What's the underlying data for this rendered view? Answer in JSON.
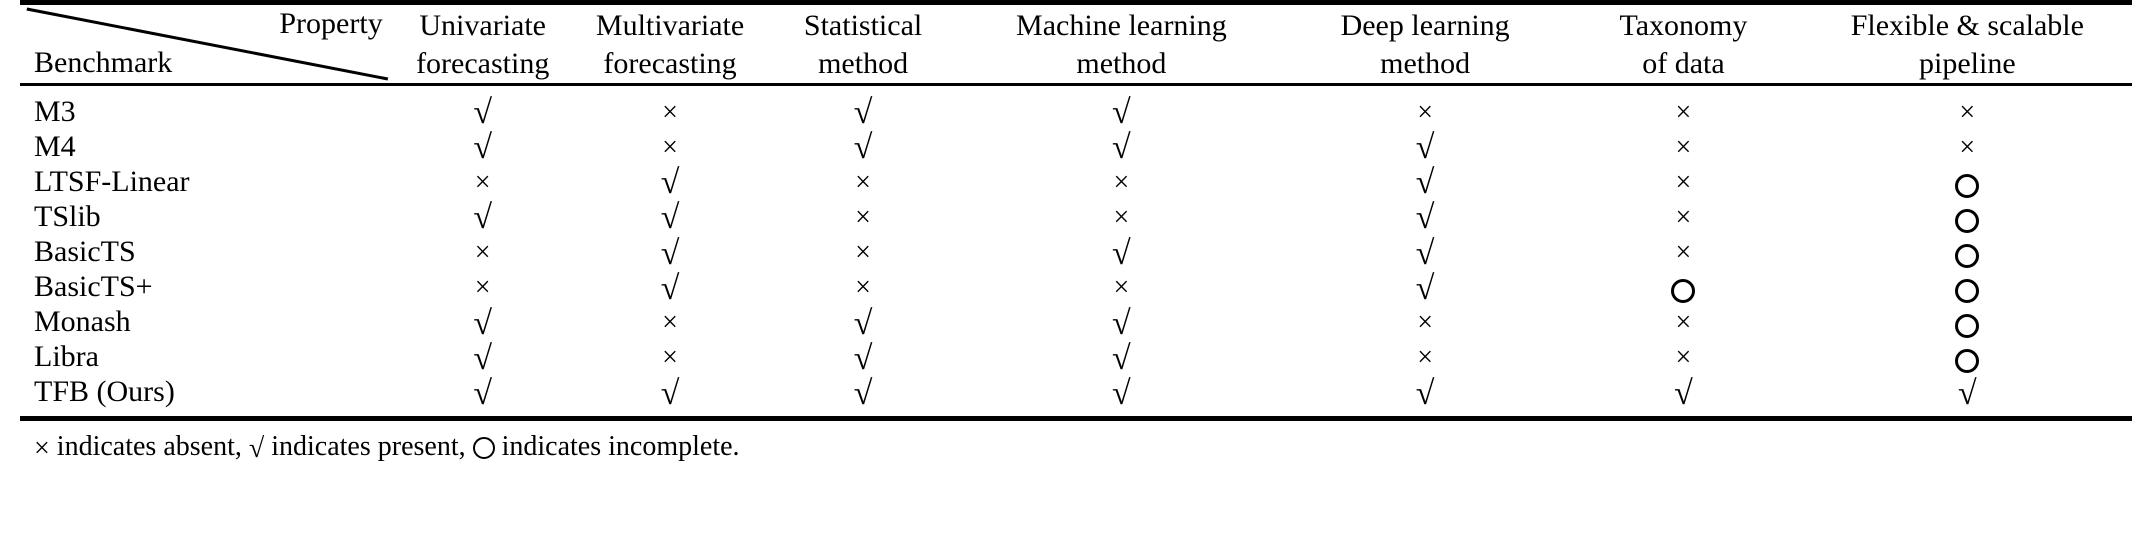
{
  "table": {
    "corner": {
      "property_label": "Property",
      "benchmark_label": "Benchmark"
    },
    "columns": [
      {
        "line1": "Univariate",
        "line2": "forecasting"
      },
      {
        "line1": "Multivariate",
        "line2": "forecasting"
      },
      {
        "line1": "Statistical",
        "line2": "method"
      },
      {
        "line1": "Machine learning",
        "line2": "method"
      },
      {
        "line1": "Deep learning",
        "line2": "method"
      },
      {
        "line1": "Taxonomy",
        "line2": "of data"
      },
      {
        "line1": "Flexible & scalable",
        "line2": "pipeline"
      }
    ],
    "rows": [
      {
        "benchmark": "M3",
        "marks": [
          "check",
          "cross",
          "check",
          "check",
          "cross",
          "cross",
          "cross"
        ]
      },
      {
        "benchmark": "M4",
        "marks": [
          "check",
          "cross",
          "check",
          "check",
          "check",
          "cross",
          "cross"
        ]
      },
      {
        "benchmark": "LTSF-Linear",
        "marks": [
          "cross",
          "check",
          "cross",
          "cross",
          "check",
          "cross",
          "circle"
        ]
      },
      {
        "benchmark": "TSlib",
        "marks": [
          "check",
          "check",
          "cross",
          "cross",
          "check",
          "cross",
          "circle"
        ]
      },
      {
        "benchmark": "BasicTS",
        "marks": [
          "cross",
          "check",
          "cross",
          "check",
          "check",
          "cross",
          "circle"
        ]
      },
      {
        "benchmark": "BasicTS+",
        "marks": [
          "cross",
          "check",
          "cross",
          "cross",
          "check",
          "circle",
          "circle"
        ]
      },
      {
        "benchmark": "Monash",
        "marks": [
          "check",
          "cross",
          "check",
          "check",
          "cross",
          "cross",
          "circle"
        ]
      },
      {
        "benchmark": "Libra",
        "marks": [
          "check",
          "cross",
          "check",
          "check",
          "cross",
          "cross",
          "circle"
        ]
      },
      {
        "benchmark": "TFB (Ours)",
        "marks": [
          "check",
          "check",
          "check",
          "check",
          "check",
          "check",
          "check"
        ]
      }
    ],
    "symbols": {
      "check": "√",
      "cross": "×",
      "circle": "◯"
    },
    "footnote": {
      "cross_text": " indicates absent, ",
      "check_text": " indicates present, ",
      "circle_text": " indicates incomplete.",
      "full_text": "× indicates absent, √ indicates present, ◯ indicates incomplete."
    }
  },
  "colors": {
    "ink": "#000000",
    "paper": "#ffffff"
  }
}
